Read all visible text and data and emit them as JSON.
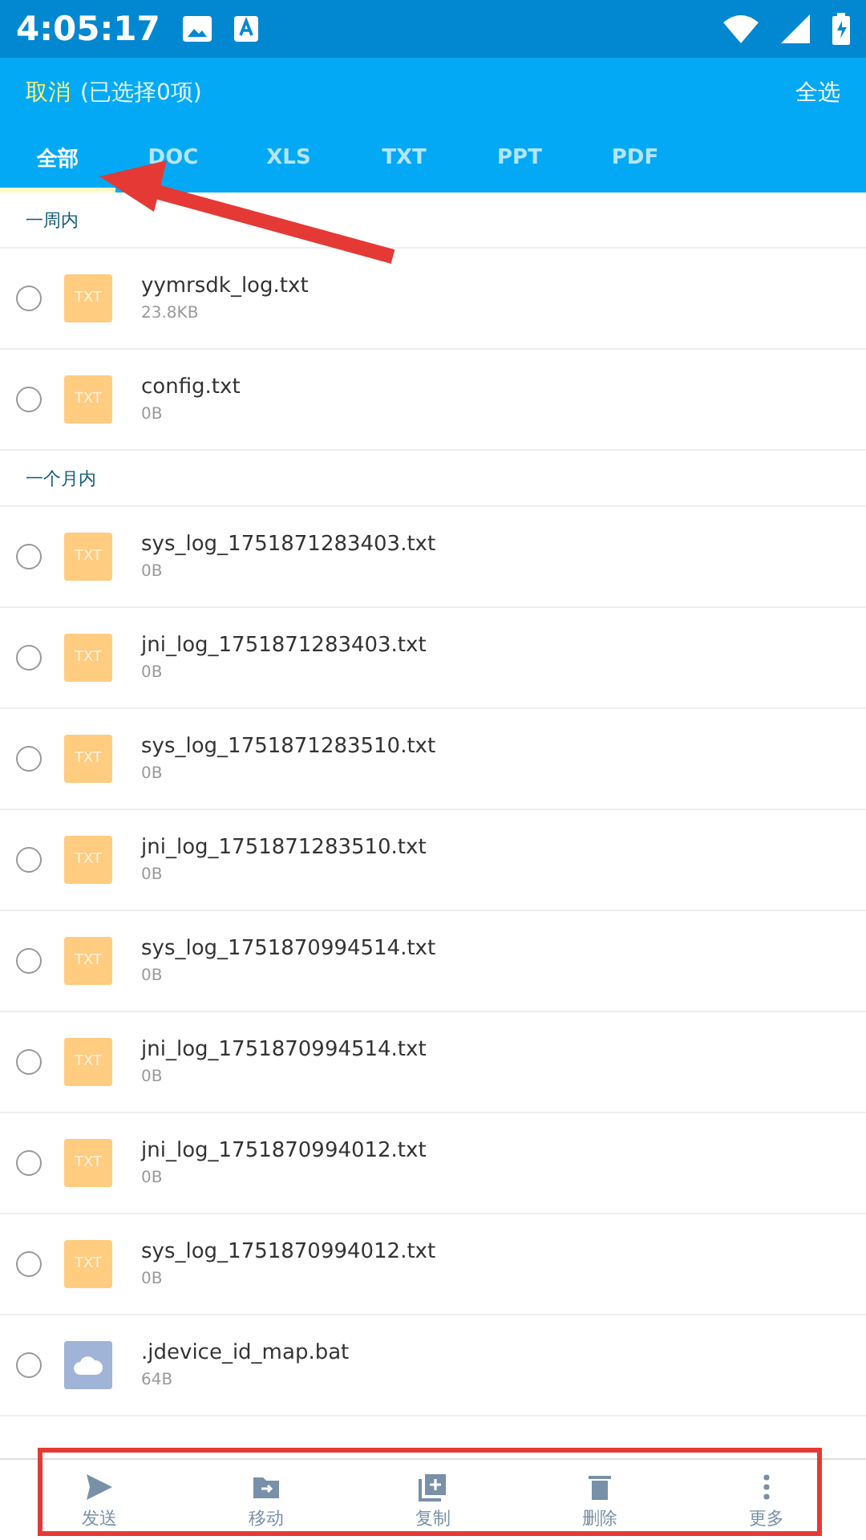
{
  "status_bar": {
    "time": "4:05:17"
  },
  "header": {
    "cancel": "取消",
    "selection": "(已选择0项)",
    "select_all": "全选"
  },
  "tabs": [
    {
      "label": "全部",
      "selected": true
    },
    {
      "label": "DOC",
      "selected": false
    },
    {
      "label": "XLS",
      "selected": false
    },
    {
      "label": "TXT",
      "selected": false
    },
    {
      "label": "PPT",
      "selected": false
    },
    {
      "label": "PDF",
      "selected": false
    }
  ],
  "sections": [
    {
      "title": "一周内",
      "files": [
        {
          "name": "yymrsdk_log.txt",
          "size": "23.8KB",
          "kind": "txt",
          "badge": "TXT",
          "checked": false
        },
        {
          "name": "config.txt",
          "size": "0B",
          "kind": "txt",
          "badge": "TXT",
          "checked": false
        }
      ]
    },
    {
      "title": "一个月内",
      "files": [
        {
          "name": "sys_log_1751871283403.txt",
          "size": "0B",
          "kind": "txt",
          "badge": "TXT",
          "checked": false
        },
        {
          "name": "jni_log_1751871283403.txt",
          "size": "0B",
          "kind": "txt",
          "badge": "TXT",
          "checked": false
        },
        {
          "name": "sys_log_1751871283510.txt",
          "size": "0B",
          "kind": "txt",
          "badge": "TXT",
          "checked": false
        },
        {
          "name": "jni_log_1751871283510.txt",
          "size": "0B",
          "kind": "txt",
          "badge": "TXT",
          "checked": false
        },
        {
          "name": "sys_log_1751870994514.txt",
          "size": "0B",
          "kind": "txt",
          "badge": "TXT",
          "checked": false
        },
        {
          "name": "jni_log_1751870994514.txt",
          "size": "0B",
          "kind": "txt",
          "badge": "TXT",
          "checked": false
        },
        {
          "name": "jni_log_1751870994012.txt",
          "size": "0B",
          "kind": "txt",
          "badge": "TXT",
          "checked": false
        },
        {
          "name": "sys_log_1751870994012.txt",
          "size": "0B",
          "kind": "txt",
          "badge": "TXT",
          "checked": false
        },
        {
          "name": ".jdevice_id_map.bat",
          "size": "64B",
          "kind": "unknown",
          "checked": false
        }
      ]
    }
  ],
  "actions": [
    {
      "label": "发送",
      "kind": "send"
    },
    {
      "label": "移动",
      "kind": "move"
    },
    {
      "label": "复制",
      "kind": "copy"
    },
    {
      "label": "删除",
      "kind": "delete"
    },
    {
      "label": "更多",
      "kind": "more"
    }
  ]
}
